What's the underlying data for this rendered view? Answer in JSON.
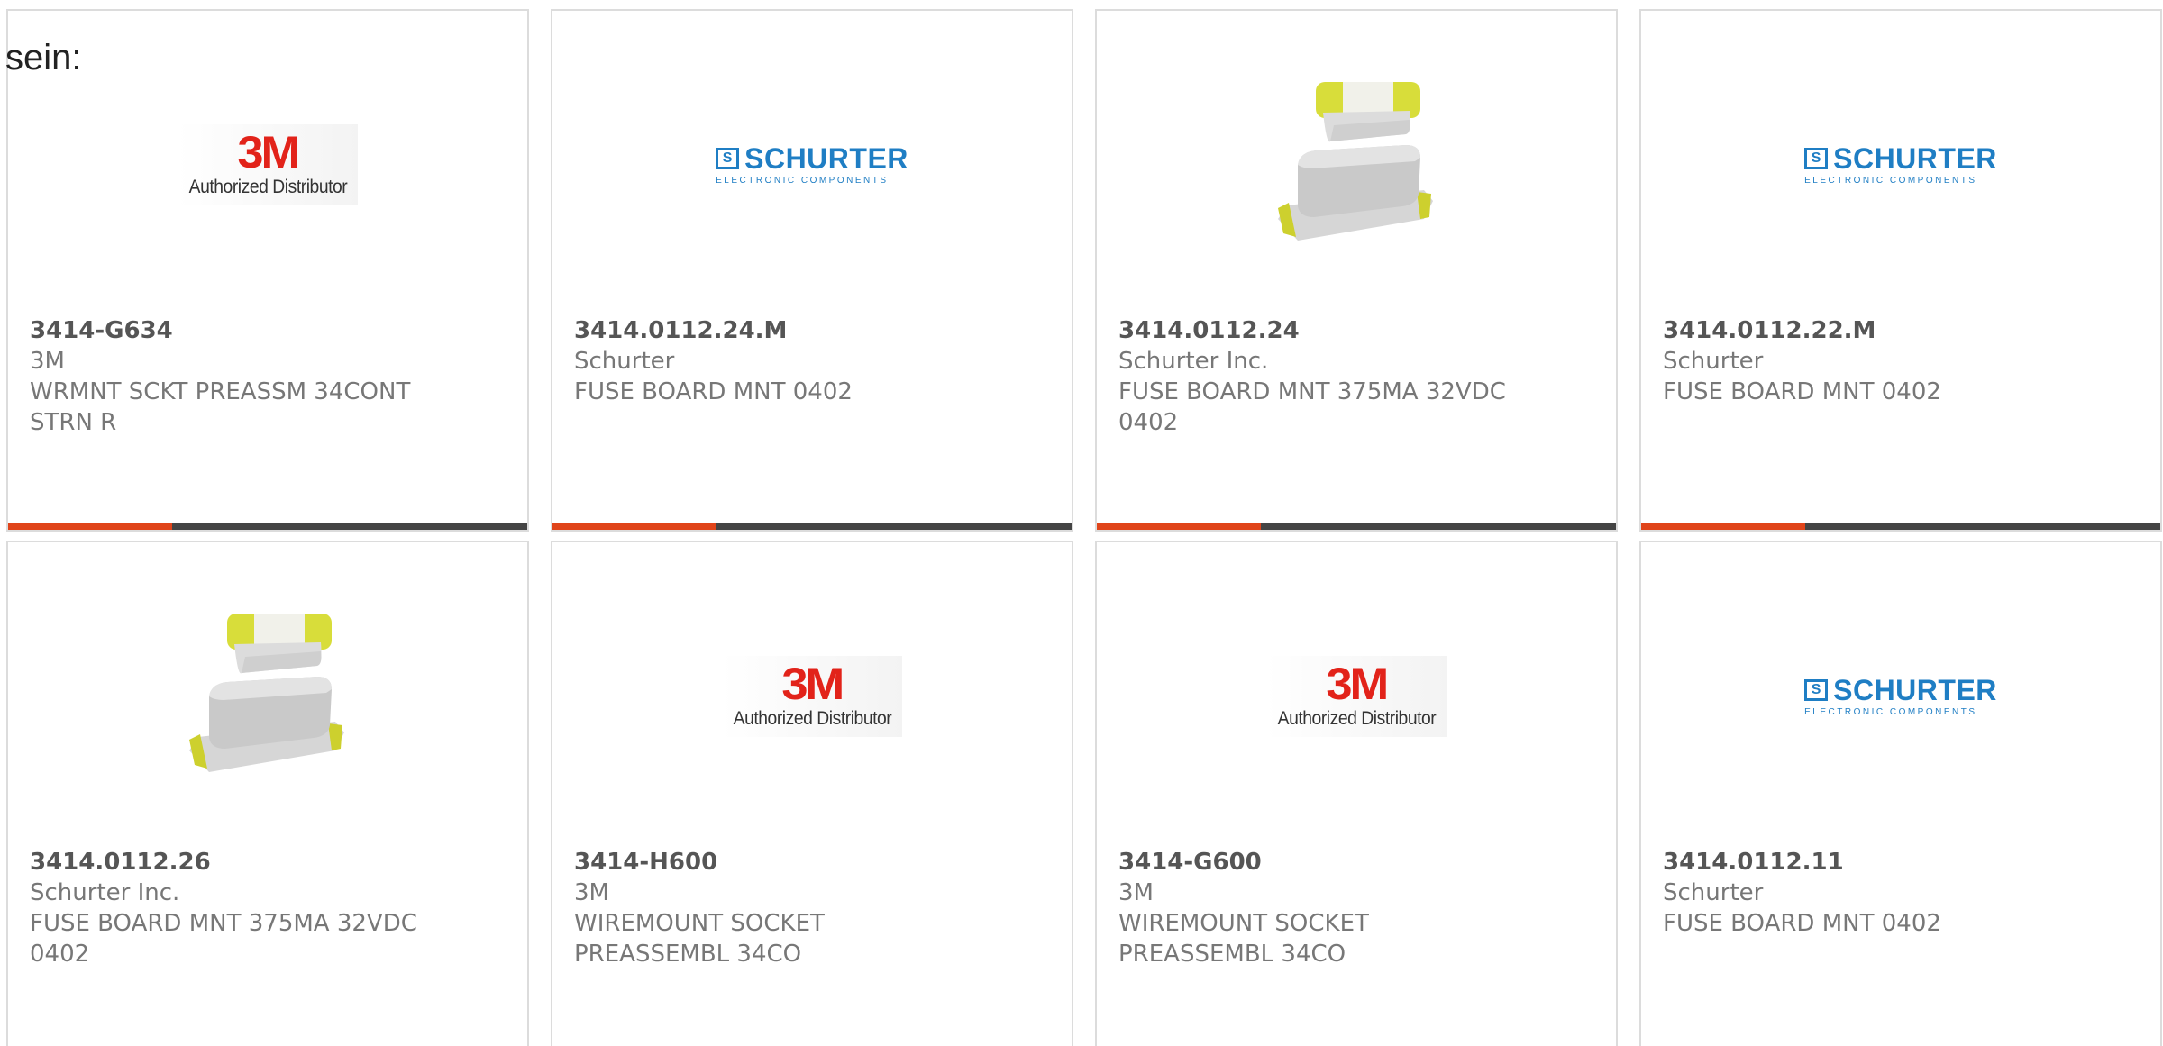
{
  "intro_text": "sein:",
  "logos": {
    "m3_mark": "3M",
    "m3_sub": "Authorized Distributor",
    "schurter_emblem": "S",
    "schurter_word": "SCHURTER",
    "schurter_tag": "ELECTRONIC COMPONENTS"
  },
  "products": [
    {
      "part_number": "3414-G634",
      "manufacturer": "3M",
      "description": "WRMNT SCKT PREASSM 34CONT STRN R",
      "image": "3m-logo"
    },
    {
      "part_number": "3414.0112.24.M",
      "manufacturer": "Schurter",
      "description": "FUSE BOARD MNT 0402",
      "image": "schurter-logo"
    },
    {
      "part_number": "3414.0112.24",
      "manufacturer": "Schurter Inc.",
      "description": "FUSE BOARD MNT 375MA 32VDC 0402",
      "image": "fuse-photo"
    },
    {
      "part_number": "3414.0112.22.M",
      "manufacturer": "Schurter",
      "description": "FUSE BOARD MNT 0402",
      "image": "schurter-logo"
    },
    {
      "part_number": "3414.0112.26",
      "manufacturer": "Schurter Inc.",
      "description": "FUSE BOARD MNT 375MA 32VDC 0402",
      "image": "fuse-photo"
    },
    {
      "part_number": "3414-H600",
      "manufacturer": "3M",
      "description": "WIREMOUNT SOCKET PREASSEMBL 34CO",
      "image": "3m-logo"
    },
    {
      "part_number": "3414-G600",
      "manufacturer": "3M",
      "description": "WIREMOUNT SOCKET PREASSEMBL 34CO",
      "image": "3m-logo"
    },
    {
      "part_number": "3414.0112.11",
      "manufacturer": "Schurter",
      "description": "FUSE BOARD MNT 0402",
      "image": "schurter-logo"
    }
  ],
  "colors": {
    "accent": "#e0441a",
    "bar_dark": "#444444",
    "brand_3m": "#e2231a",
    "brand_schurter": "#1f7ec4"
  }
}
